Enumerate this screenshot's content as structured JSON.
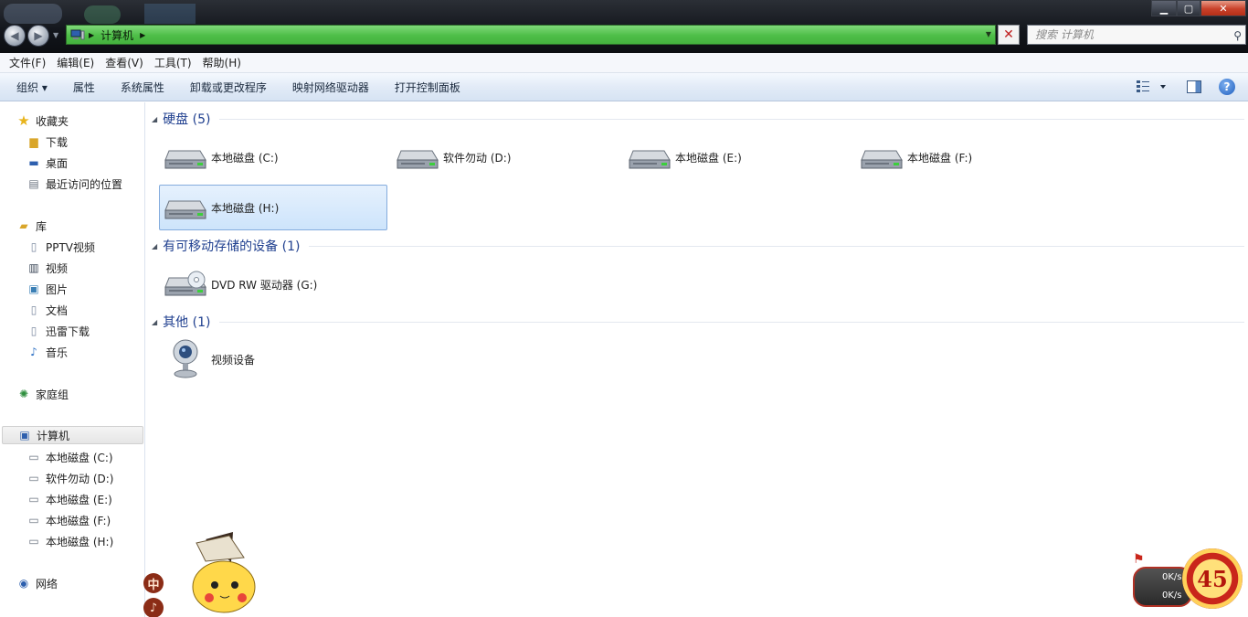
{
  "window": {
    "breadcrumb": "计算机",
    "search_placeholder": "搜索 计算机",
    "controls": {
      "minimize": "▁",
      "maximize": "▢",
      "close": "✕"
    }
  },
  "menu": [
    "文件(F)",
    "编辑(E)",
    "查看(V)",
    "工具(T)",
    "帮助(H)"
  ],
  "commands": [
    "组织 ▾",
    "属性",
    "系统属性",
    "卸载或更改程序",
    "映射网络驱动器",
    "打开控制面板"
  ],
  "sidebar": {
    "favorites": {
      "label": "收藏夹",
      "items": [
        "下载",
        "桌面",
        "最近访问的位置"
      ]
    },
    "libraries": {
      "label": "库",
      "items": [
        "PPTV视频",
        "视频",
        "图片",
        "文档",
        "迅雷下载",
        "音乐"
      ]
    },
    "homegroup": "家庭组",
    "computer": {
      "label": "计算机",
      "items": [
        "本地磁盘 (C:)",
        "软件勿动 (D:)",
        "本地磁盘 (E:)",
        "本地磁盘 (F:)",
        "本地磁盘 (H:)"
      ]
    },
    "network": "网络"
  },
  "groups": {
    "hdd": {
      "title": "硬盘 (5)",
      "items": [
        "本地磁盘 (C:)",
        "软件勿动 (D:)",
        "本地磁盘 (E:)",
        "本地磁盘 (F:)",
        "本地磁盘 (H:)"
      ]
    },
    "removable": {
      "title": "有可移动存储的设备 (1)",
      "items": [
        "DVD RW 驱动器 (G:)"
      ]
    },
    "other": {
      "title": "其他 (1)",
      "items": [
        "视频设备"
      ]
    }
  },
  "overlay": {
    "ime_mode": "中",
    "ime_symbol": "♪",
    "upload_speed": "0K/s",
    "download_speed": "0K/s",
    "badge_number": "45"
  },
  "colors": {
    "address_bar": "#4ebe48",
    "selection": "#cde4fb",
    "group_title": "#1f3f8f"
  }
}
